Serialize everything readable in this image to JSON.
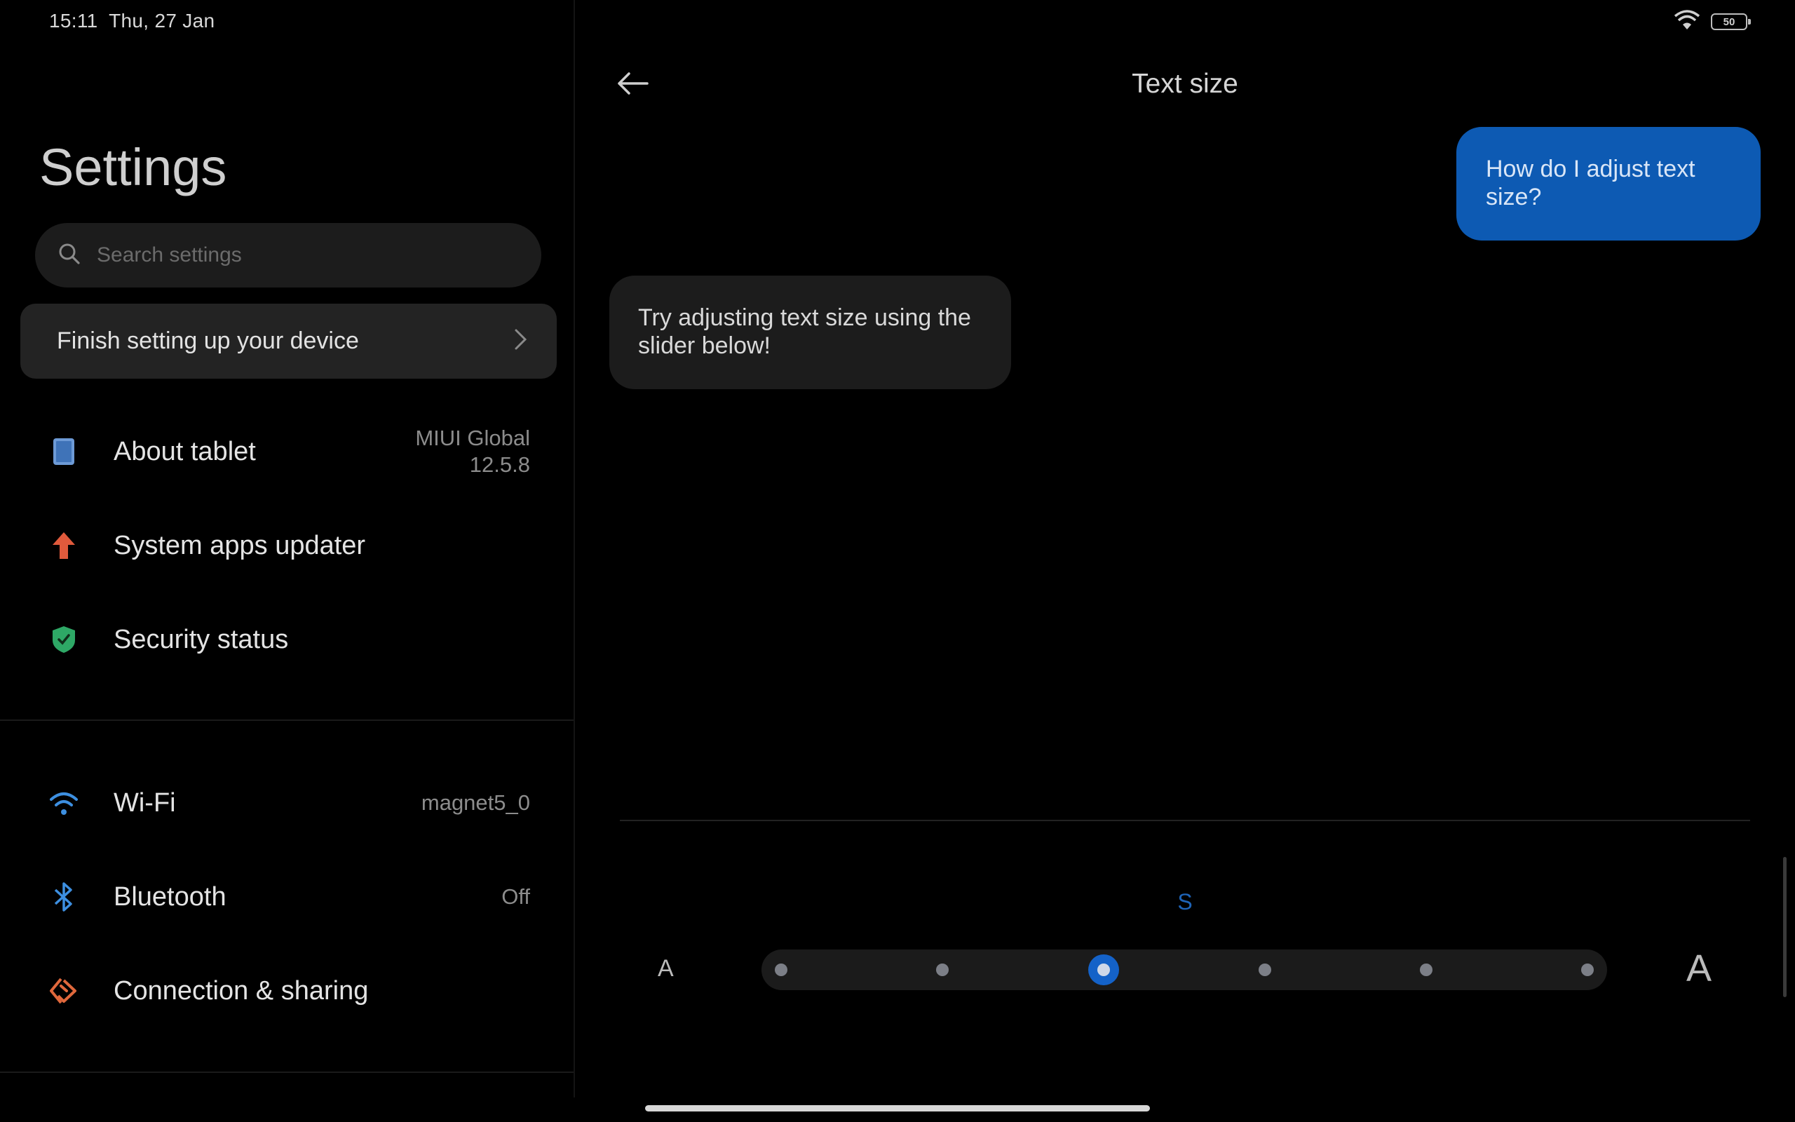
{
  "status_bar": {
    "time": "15:11",
    "date": "Thu, 27 Jan",
    "battery": "50",
    "wifi_icon": "wifi-icon"
  },
  "left": {
    "title": "Settings",
    "search": {
      "placeholder": "Search settings",
      "value": ""
    },
    "finish_card": {
      "label": "Finish setting up your device"
    },
    "items": [
      {
        "label": "About tablet",
        "value_line1": "MIUI Global",
        "value_line2": "12.5.8",
        "icon": "tablet-icon",
        "color": "#4a7fc1"
      },
      {
        "label": "System apps updater",
        "value": "",
        "icon": "arrow-up-icon",
        "color": "#e05a3c"
      },
      {
        "label": "Security status",
        "value": "",
        "icon": "shield-icon",
        "color": "#2ea866"
      },
      {
        "label": "Wi-Fi",
        "value": "magnet5_0",
        "icon": "wifi-icon",
        "color": "#3d8fe0"
      },
      {
        "label": "Bluetooth",
        "value": "Off",
        "icon": "bluetooth-icon",
        "color": "#3d8fe0"
      },
      {
        "label": "Connection & sharing",
        "value": "",
        "icon": "connection-sharing-icon",
        "color": "#e0683c"
      }
    ]
  },
  "right": {
    "title": "Text size",
    "user_message": "How do I adjust text size?",
    "bot_message": "Try adjusting text size using the slider below!",
    "size_indicator": "S",
    "a_small": "A",
    "a_large": "A",
    "slider": {
      "steps": 6,
      "selected_index": 2
    },
    "accent_color": "#1462c8"
  }
}
